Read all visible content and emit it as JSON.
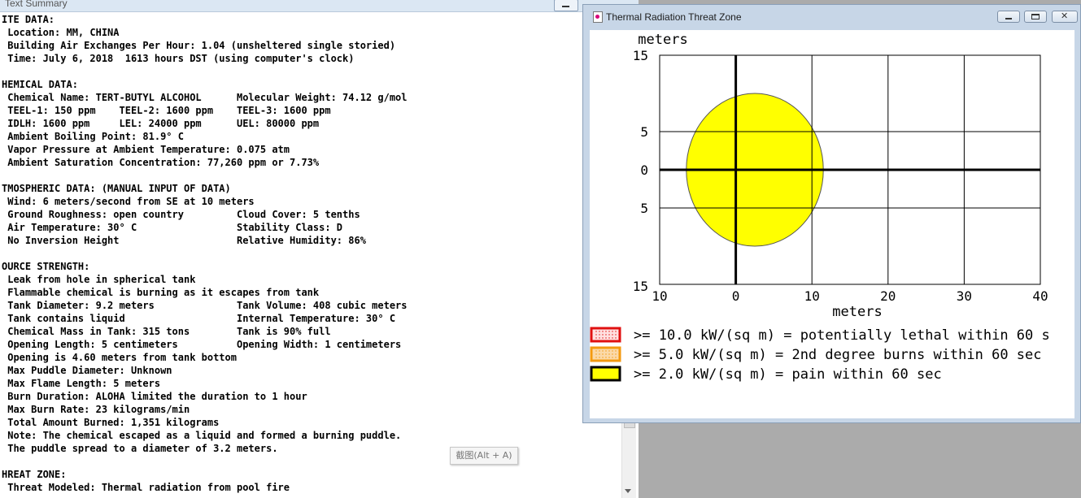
{
  "text_window": {
    "title": "Text Summary",
    "lines": [
      "ITE DATA:",
      " Location: MM, CHINA",
      " Building Air Exchanges Per Hour: 1.04 (unsheltered single storied)",
      " Time: July 6, 2018  1613 hours DST (using computer's clock)",
      "",
      "HEMICAL DATA:",
      " Chemical Name: TERT-BUTYL ALCOHOL      Molecular Weight: 74.12 g/mol",
      " TEEL-1: 150 ppm    TEEL-2: 1600 ppm    TEEL-3: 1600 ppm",
      " IDLH: 1600 ppm     LEL: 24000 ppm      UEL: 80000 ppm",
      " Ambient Boiling Point: 81.9° C",
      " Vapor Pressure at Ambient Temperature: 0.075 atm",
      " Ambient Saturation Concentration: 77,260 ppm or 7.73%",
      "",
      "TMOSPHERIC DATA: (MANUAL INPUT OF DATA)",
      " Wind: 6 meters/second from SE at 10 meters",
      " Ground Roughness: open country         Cloud Cover: 5 tenths",
      " Air Temperature: 30° C                 Stability Class: D",
      " No Inversion Height                    Relative Humidity: 86%",
      "",
      "OURCE STRENGTH:",
      " Leak from hole in spherical tank",
      " Flammable chemical is burning as it escapes from tank",
      " Tank Diameter: 9.2 meters              Tank Volume: 408 cubic meters",
      " Tank contains liquid                   Internal Temperature: 30° C",
      " Chemical Mass in Tank: 315 tons        Tank is 90% full",
      " Opening Length: 5 centimeters          Opening Width: 1 centimeters",
      " Opening is 4.60 meters from tank bottom",
      " Max Puddle Diameter: Unknown",
      " Max Flame Length: 5 meters",
      " Burn Duration: ALOHA limited the duration to 1 hour",
      " Max Burn Rate: 23 kilograms/min",
      " Total Amount Burned: 1,351 kilograms",
      " Note: The chemical escaped as a liquid and formed a burning puddle.",
      " The puddle spread to a diameter of 3.2 meters.",
      "",
      "HREAT ZONE:",
      " Threat Modeled: Thermal radiation from pool fire"
    ]
  },
  "tooltip": {
    "text": "截图(Alt + A)"
  },
  "threat_window": {
    "title": "Thermal Radiation Threat Zone",
    "buttons": {
      "minimize": "minimize",
      "maximize": "maximize",
      "close": "close"
    },
    "legend": [
      {
        "label": ">= 10.0 kW/(sq m) = potentially lethal within 60 s",
        "border": "#e01010",
        "fill": "#ffe0e0"
      },
      {
        "label": ">= 5.0 kW/(sq m) = 2nd degree burns within 60 sec",
        "border": "#f39a10",
        "fill": "#fbd9a8"
      },
      {
        "label": ">= 2.0 kW/(sq m) = pain within 60 sec",
        "border": "#000000",
        "fill": "#ffff00"
      }
    ]
  },
  "chart_data": {
    "type": "threat-zone-plot",
    "y_axis_title": "meters",
    "x_axis_title": "meters",
    "x_ticks": [
      -10,
      0,
      10,
      20,
      30,
      40
    ],
    "x_tick_labels": [
      "10",
      "0",
      "10",
      "20",
      "30",
      "40"
    ],
    "y_ticks": [
      15,
      5,
      0,
      -5,
      -15
    ],
    "y_tick_labels": [
      "15",
      "5",
      "0",
      "5",
      "15"
    ],
    "xlim": [
      -10,
      40
    ],
    "ylim": [
      -15,
      15
    ],
    "grid": true,
    "zones": [
      {
        "level": ">= 2.0 kW/(sq m)",
        "color": "#ffff00",
        "center": [
          2.5,
          0
        ],
        "rx": 9,
        "ry": 10
      }
    ],
    "colors": {
      "zone_fill": "#ffff00",
      "zone_stroke": "#555555",
      "axis": "#000000"
    }
  }
}
